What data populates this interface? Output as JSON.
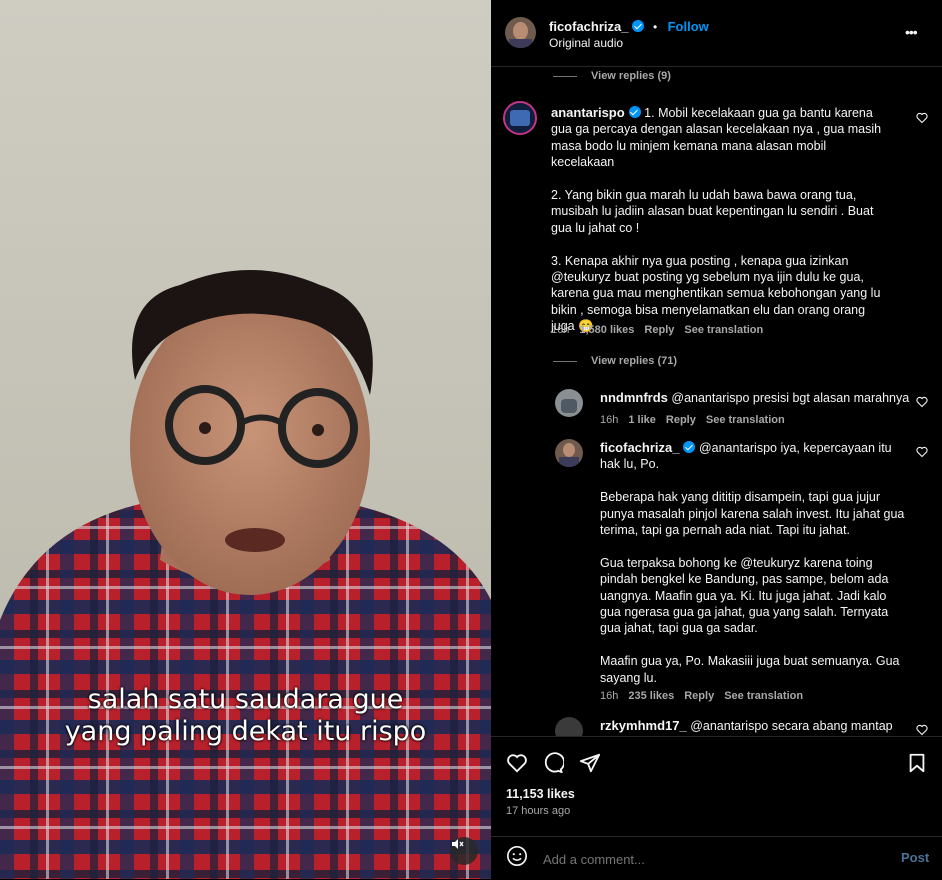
{
  "video": {
    "caption_line1": "salah satu saudara gue",
    "caption_line2": "yang paling dekat itu rispo"
  },
  "header": {
    "username": "ficofachriza_",
    "follow_label": "Follow",
    "separator": "•",
    "audio": "Original audio",
    "more": "•••"
  },
  "comments": {
    "view_replies_top": "View replies (9)",
    "main": {
      "username": "anantarispo",
      "text": "1. Mobil kecelakaan gua ga bantu karena gua ga percaya dengan alasan kecelakaan nya , gua masih masa bodo lu minjem kemana mana alasan mobil kecelakaan\n\n2. Yang bikin gua marah lu udah bawa bawa orang tua, musibah lu jadiin alasan buat kepentingan lu sendiri . Buat gua lu jahat co !\n\n3. Kenapa akhir nya gua posting , kenapa gua izinkan @teukuryz buat posting yg sebelum nya ijin dulu ke gua, karena gua mau menghentikan semua kebohongan yang lu bikin , semoga bisa menyelamatkan elu dan orang orang juga 😁",
      "time": "16h",
      "likes": "1,580 likes",
      "reply": "Reply",
      "translate": "See translation",
      "view_replies": "View replies (71)"
    },
    "replies": [
      {
        "username": "nndmnfrds",
        "text": "@anantarispo presisi bgt alasan marahnya",
        "time": "16h",
        "likes": "1 like",
        "reply": "Reply",
        "translate": "See translation"
      },
      {
        "username": "ficofachriza_",
        "text": "@anantarispo iya, kepercayaan itu hak lu, Po.\n\nBeberapa hak yang dititip disampein, tapi gua jujur punya masalah pinjol karena salah invest. Itu jahat gua terima, tapi ga pernah ada niat. Tapi itu jahat.\n\nGua terpaksa bohong ke @teukuryz karena toing pindah bengkel ke Bandung, pas sampe, belom ada uangnya. Maafin gua ya. Ki. Itu juga jahat. Jadi kalo gua ngerasa gua ga jahat, gua yang salah. Ternyata gua jahat, tapi gua ga sadar.\n\nMaafin gua ya, Po. Makasiii juga buat semuanya. Gua sayang lu.",
        "time": "16h",
        "likes": "235 likes",
        "reply": "Reply",
        "translate": "See translation"
      },
      {
        "username": "rzkymhmd17_",
        "text": "@anantarispo secara abang mantap"
      }
    ]
  },
  "footer": {
    "likes": "11,153 likes",
    "time": "17 hours ago",
    "placeholder": "Add a comment...",
    "post": "Post"
  },
  "colors": {
    "accent": "#0095f6",
    "muted": "#a8a8a8",
    "background": "#000000"
  },
  "icons": [
    "mute-icon",
    "verified-icon",
    "more-icon",
    "heart-icon",
    "comment-icon",
    "share-icon",
    "save-icon",
    "emoji-icon"
  ]
}
